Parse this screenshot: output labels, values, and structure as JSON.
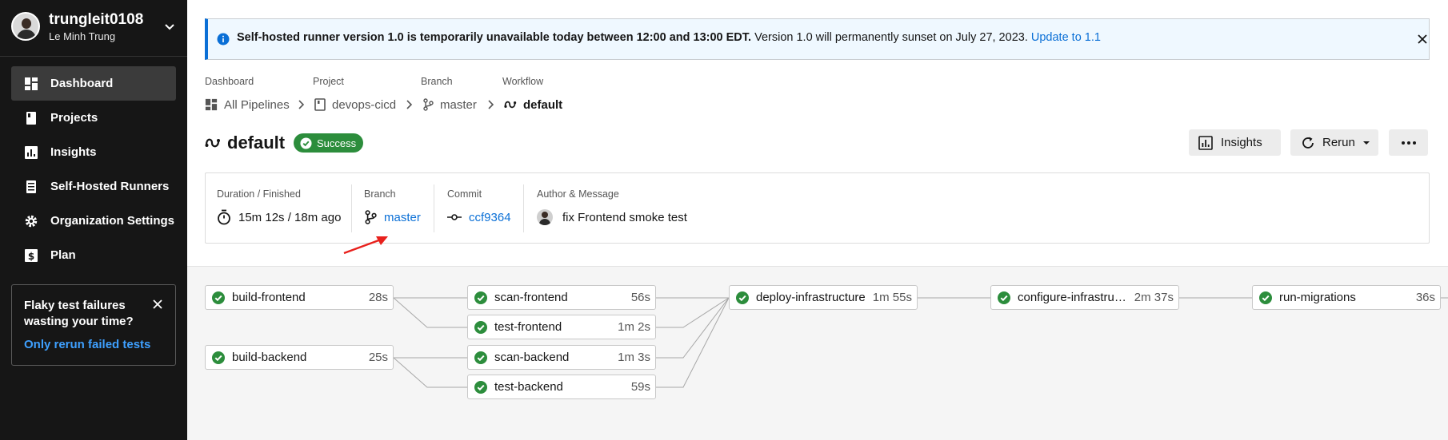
{
  "user": {
    "username": "trungleit0108",
    "full_name": "Le Minh Trung"
  },
  "sidebar": {
    "items": [
      {
        "label": "Dashboard",
        "icon": "dashboard-icon",
        "active": true
      },
      {
        "label": "Projects",
        "icon": "projects-icon",
        "active": false
      },
      {
        "label": "Insights",
        "icon": "insights-icon",
        "active": false
      },
      {
        "label": "Self-Hosted Runners",
        "icon": "runners-icon",
        "active": false
      },
      {
        "label": "Organization Settings",
        "icon": "gear-icon",
        "active": false
      },
      {
        "label": "Plan",
        "icon": "plan-icon",
        "active": false
      }
    ],
    "promo": {
      "title": "Flaky test failures wasting your time?",
      "link": "Only rerun failed tests"
    }
  },
  "banner": {
    "bold_text": "Self-hosted runner version 1.0 is temporarily unavailable today between 12:00 and 13:00 EDT.",
    "text": " Version 1.0 will permanently sunset on July 27, 2023. ",
    "link": "Update to 1.1"
  },
  "breadcrumb": {
    "labels": {
      "dashboard": "Dashboard",
      "project": "Project",
      "branch": "Branch",
      "workflow": "Workflow"
    },
    "values": {
      "dashboard": "All Pipelines",
      "project": "devops-cicd",
      "branch": "master",
      "workflow": "default"
    }
  },
  "workflow": {
    "title": "default",
    "status": "Success"
  },
  "actions": {
    "insights": "Insights",
    "rerun": "Rerun"
  },
  "summary": {
    "duration_label": "Duration / Finished",
    "duration_value": "15m 12s / 18m ago",
    "branch_label": "Branch",
    "branch_value": "master",
    "commit_label": "Commit",
    "commit_value": "ccf9364",
    "author_label": "Author & Message",
    "message": "fix Frontend smoke test"
  },
  "jobs": {
    "build_frontend": {
      "name": "build-frontend",
      "duration": "28s",
      "status": "success"
    },
    "build_backend": {
      "name": "build-backend",
      "duration": "25s",
      "status": "success"
    },
    "scan_frontend": {
      "name": "scan-frontend",
      "duration": "56s",
      "status": "success"
    },
    "test_frontend": {
      "name": "test-frontend",
      "duration": "1m 2s",
      "status": "success"
    },
    "scan_backend": {
      "name": "scan-backend",
      "duration": "1m 3s",
      "status": "success"
    },
    "test_backend": {
      "name": "test-backend",
      "duration": "59s",
      "status": "success"
    },
    "deploy_infrastructure": {
      "name": "deploy-infrastructure",
      "duration": "1m 55s",
      "status": "success"
    },
    "configure_infrastructure": {
      "name": "configure-infrastructure",
      "duration": "2m 37s",
      "status": "success"
    },
    "run_migrations": {
      "name": "run-migrations",
      "duration": "36s",
      "status": "success"
    }
  },
  "colors": {
    "success": "#2c8d3c",
    "link": "#0a6fd6",
    "sidebar_bg": "#161616",
    "annotation_arrow": "#e8201c"
  }
}
